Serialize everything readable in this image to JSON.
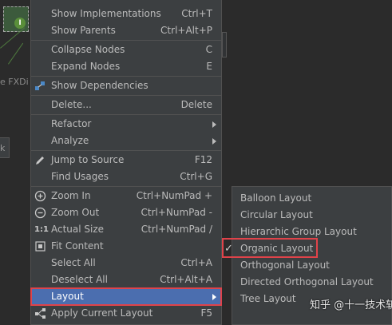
{
  "background": {
    "node_badge": "I",
    "tab_text": "e  FXDi",
    "left_box_text": "k"
  },
  "menu": {
    "items": [
      {
        "label": "Show Implementations",
        "shortcut": "Ctrl+T",
        "icon": ""
      },
      {
        "label": "Show Parents",
        "shortcut": "Ctrl+Alt+P",
        "icon": ""
      },
      {
        "label": "Collapse Nodes",
        "shortcut": "C",
        "icon": ""
      },
      {
        "label": "Expand Nodes",
        "shortcut": "E",
        "icon": ""
      },
      {
        "label": "Show Dependencies",
        "shortcut": "",
        "icon": "dependencies-icon"
      },
      {
        "label": "Delete...",
        "shortcut": "Delete",
        "icon": ""
      },
      {
        "label": "Refactor",
        "shortcut": "",
        "icon": "",
        "submenu": true
      },
      {
        "label": "Analyze",
        "shortcut": "",
        "icon": "",
        "submenu": true
      },
      {
        "label": "Jump to Source",
        "shortcut": "F12",
        "icon": "edit-pencil-icon"
      },
      {
        "label": "Find Usages",
        "shortcut": "Ctrl+G",
        "icon": ""
      },
      {
        "label": "Zoom In",
        "shortcut": "Ctrl+NumPad +",
        "icon": "zoom-in-icon"
      },
      {
        "label": "Zoom Out",
        "shortcut": "Ctrl+NumPad -",
        "icon": "zoom-out-icon"
      },
      {
        "label": "Actual Size",
        "shortcut": "Ctrl+NumPad /",
        "icon": "actual-size-icon"
      },
      {
        "label": "Fit Content",
        "shortcut": "",
        "icon": "fit-content-icon"
      },
      {
        "label": "Select All",
        "shortcut": "Ctrl+A",
        "icon": ""
      },
      {
        "label": "Deselect All",
        "shortcut": "Ctrl+Alt+A",
        "icon": ""
      },
      {
        "label": "Layout",
        "shortcut": "",
        "icon": "",
        "submenu": true,
        "selected": true
      },
      {
        "label": "Apply Current Layout",
        "shortcut": "F5",
        "icon": "apply-layout-icon"
      }
    ]
  },
  "submenu": {
    "items": [
      {
        "label": "Balloon Layout"
      },
      {
        "label": "Circular Layout"
      },
      {
        "label": "Hierarchic Group Layout"
      },
      {
        "label": "Organic Layout",
        "checked": true
      },
      {
        "label": "Orthogonal Layout"
      },
      {
        "label": "Directed Orthogonal Layout"
      },
      {
        "label": "Tree Layout"
      }
    ]
  },
  "watermark": "知乎 @十一技术斩",
  "colors": {
    "menu_bg": "#3c3f41",
    "selected_bg": "#4b6eaf",
    "highlight_red": "#e0434a",
    "text": "#bbbbbb"
  }
}
